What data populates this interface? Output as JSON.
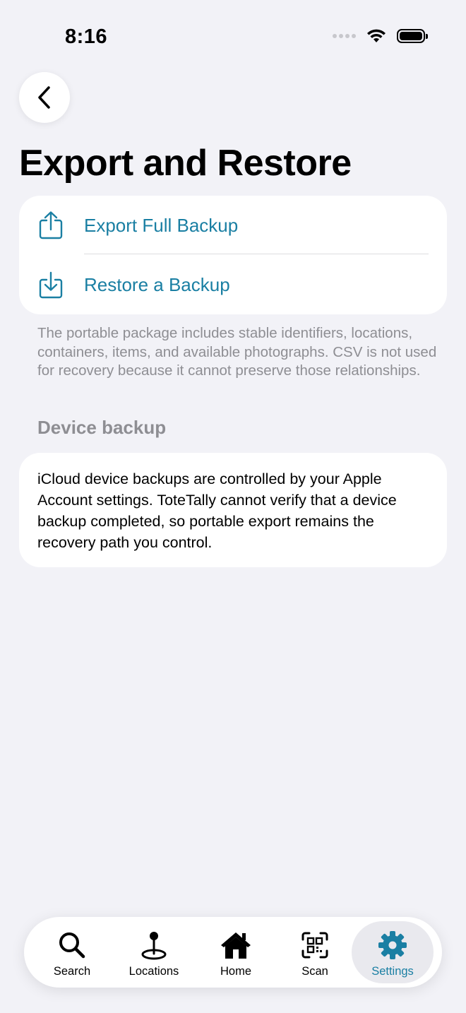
{
  "status_bar": {
    "time": "8:16"
  },
  "page": {
    "title": "Export and Restore"
  },
  "actions": {
    "export_label": "Export Full Backup",
    "restore_label": "Restore a Backup"
  },
  "portable_note": "The portable package includes stable identifiers, locations, containers, items, and available photographs. CSV is not used for recovery because it cannot preserve those relationships.",
  "device_backup": {
    "header": "Device backup",
    "text": "iCloud device backups are controlled by your Apple Account settings. ToteTally cannot verify that a device backup completed, so portable export remains the recovery path you control."
  },
  "tab_bar": {
    "active": "Settings",
    "tabs": [
      {
        "label": "Search",
        "icon": "magnifying-glass-icon"
      },
      {
        "label": "Locations",
        "icon": "map-pin-icon"
      },
      {
        "label": "Home",
        "icon": "house-icon"
      },
      {
        "label": "Scan",
        "icon": "qr-code-icon"
      },
      {
        "label": "Settings",
        "icon": "gear-icon"
      }
    ]
  },
  "colors": {
    "accent": "#1a7fa3",
    "background": "#f2f2f7",
    "secondary_text": "#8e8e93"
  }
}
